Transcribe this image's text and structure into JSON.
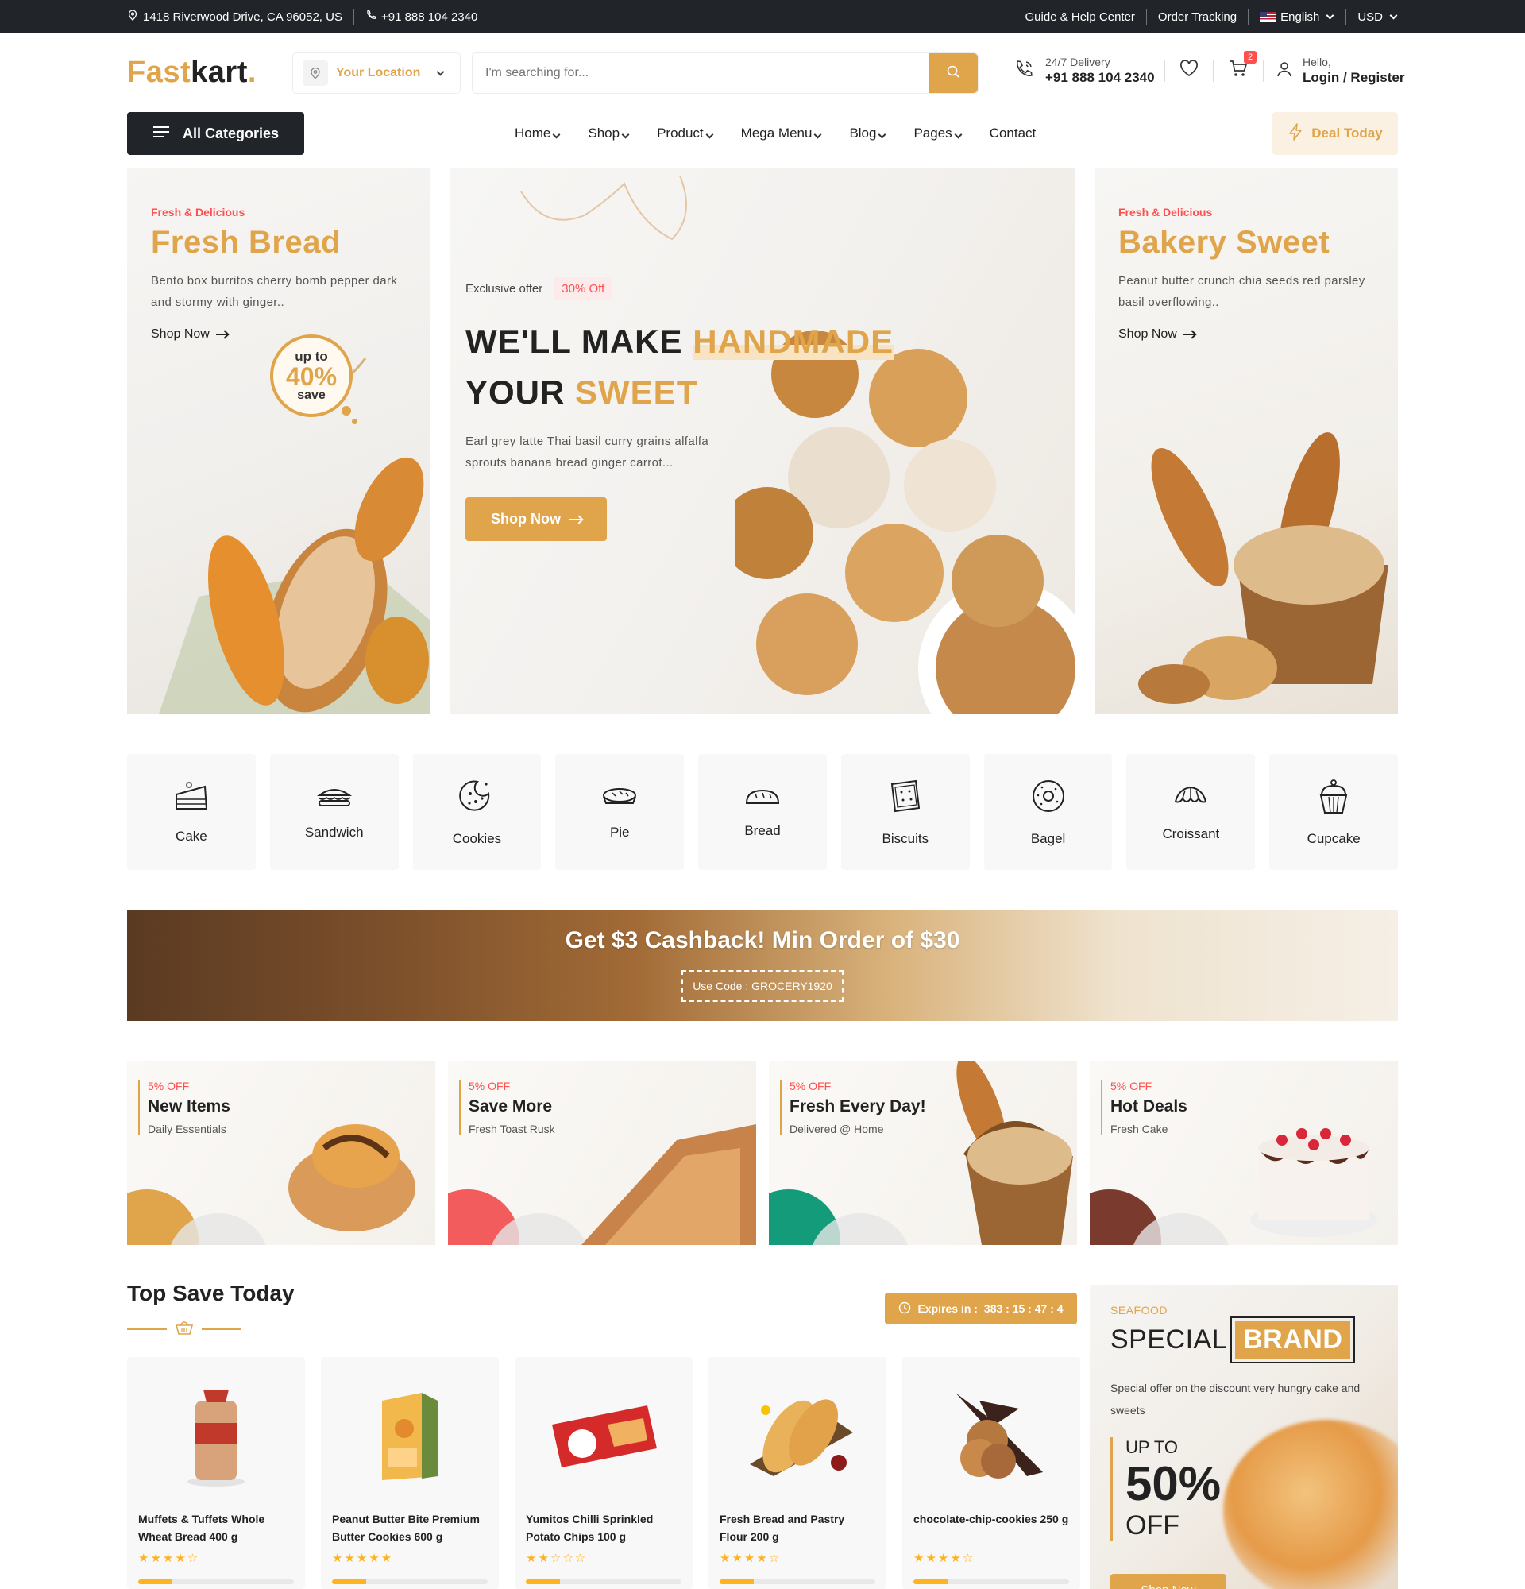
{
  "topbar": {
    "address": "1418 Riverwood Drive, CA 96052, US",
    "phone": "+91 888 104 2340",
    "guide": "Guide & Help Center",
    "tracking": "Order Tracking",
    "language": "English",
    "currency": "USD"
  },
  "header": {
    "logo_part1": "Fast",
    "logo_part2": "kart",
    "logo_dot": ".",
    "location_label": "Your Location",
    "search_placeholder": "I'm searching for...",
    "delivery_label": "24/7 Delivery",
    "delivery_phone": "+91 888 104 2340",
    "cart_count": "2",
    "hello": "Hello,",
    "login": "Login / Register"
  },
  "nav": {
    "all_categories": "All Categories",
    "items": [
      "Home",
      "Shop",
      "Product",
      "Mega Menu",
      "Blog",
      "Pages",
      "Contact"
    ],
    "deal": "Deal Today"
  },
  "hero": {
    "left": {
      "eyebrow": "Fresh & Delicious",
      "title": "Fresh Bread",
      "desc_line1": "Bento box burritos cherry bomb pepper dark",
      "desc_line2": "and stormy with ginger..",
      "shop": "Shop Now",
      "save_up": "up to",
      "save_pct": "40%",
      "save_word": "save"
    },
    "center": {
      "exclusive": "Exclusive offer",
      "discount": "30% Off",
      "line1_a": "WE'LL MAKE ",
      "line1_b": "HANDMADE",
      "line2_a": "YOUR ",
      "line2_b": "SWEET",
      "desc_line1": "Earl grey latte Thai basil curry grains alfalfa",
      "desc_line2": "sprouts banana bread ginger carrot...",
      "button": "Shop Now"
    },
    "right": {
      "eyebrow": "Fresh & Delicious",
      "title": "Bakery Sweet",
      "desc_line1": "Peanut butter crunch chia seeds red parsley",
      "desc_line2": "basil overflowing..",
      "shop": "Shop Now"
    }
  },
  "categories": [
    "Cake",
    "Sandwich",
    "Cookies",
    "Pie",
    "Bread",
    "Biscuits",
    "Bagel",
    "Croissant",
    "Cupcake"
  ],
  "cashback": {
    "title": "Get $3 Cashback! Min Order of $30",
    "code": "Use Code : GROCERY1920"
  },
  "promos": [
    {
      "off": "5% OFF",
      "title": "New Items",
      "sub": "Daily Essentials",
      "accent": "#e0a44b"
    },
    {
      "off": "5% OFF",
      "title": "Save More",
      "sub": "Fresh Toast Rusk",
      "accent": "#f25c5c"
    },
    {
      "off": "5% OFF",
      "title": "Fresh Every Day!",
      "sub": "Delivered @ Home",
      "accent": "#149b7a"
    },
    {
      "off": "5% OFF",
      "title": "Hot Deals",
      "sub": "Fresh Cake",
      "accent": "#7a3b2e"
    }
  ],
  "top_save": {
    "title": "Top Save Today",
    "expires_label": "Expires in :",
    "expires_value": "383 : 15 : 47 : 4"
  },
  "products": [
    {
      "name": "Muffets & Tuffets Whole Wheat Bread 400 g",
      "stars": "★★★★☆",
      "sold": 0.22
    },
    {
      "name": "Peanut Butter Bite Premium Butter Cookies 600 g",
      "stars": "★★★★★",
      "sold": 0.22
    },
    {
      "name": "Yumitos Chilli Sprinkled Potato Chips 100 g",
      "stars": "★★☆☆☆",
      "sold": 0.22
    },
    {
      "name": "Fresh Bread and Pastry Flour 200 g",
      "stars": "★★★★☆",
      "sold": 0.22
    },
    {
      "name": "chocolate-chip-cookies 250 g",
      "stars": "★★★★☆",
      "sold": 0.22
    }
  ],
  "special": {
    "eyebrow": "SEAFOOD",
    "title_a": "SPECIAL",
    "title_b": "BRAND",
    "desc": "Special offer on the discount very hungry cake and sweets",
    "up_to": "UP TO",
    "pct": "50%",
    "off": "OFF",
    "button": "Shop Now"
  },
  "colors": {
    "accent": "#e0a44b",
    "dark": "#212529",
    "red": "#ff4f4f"
  }
}
